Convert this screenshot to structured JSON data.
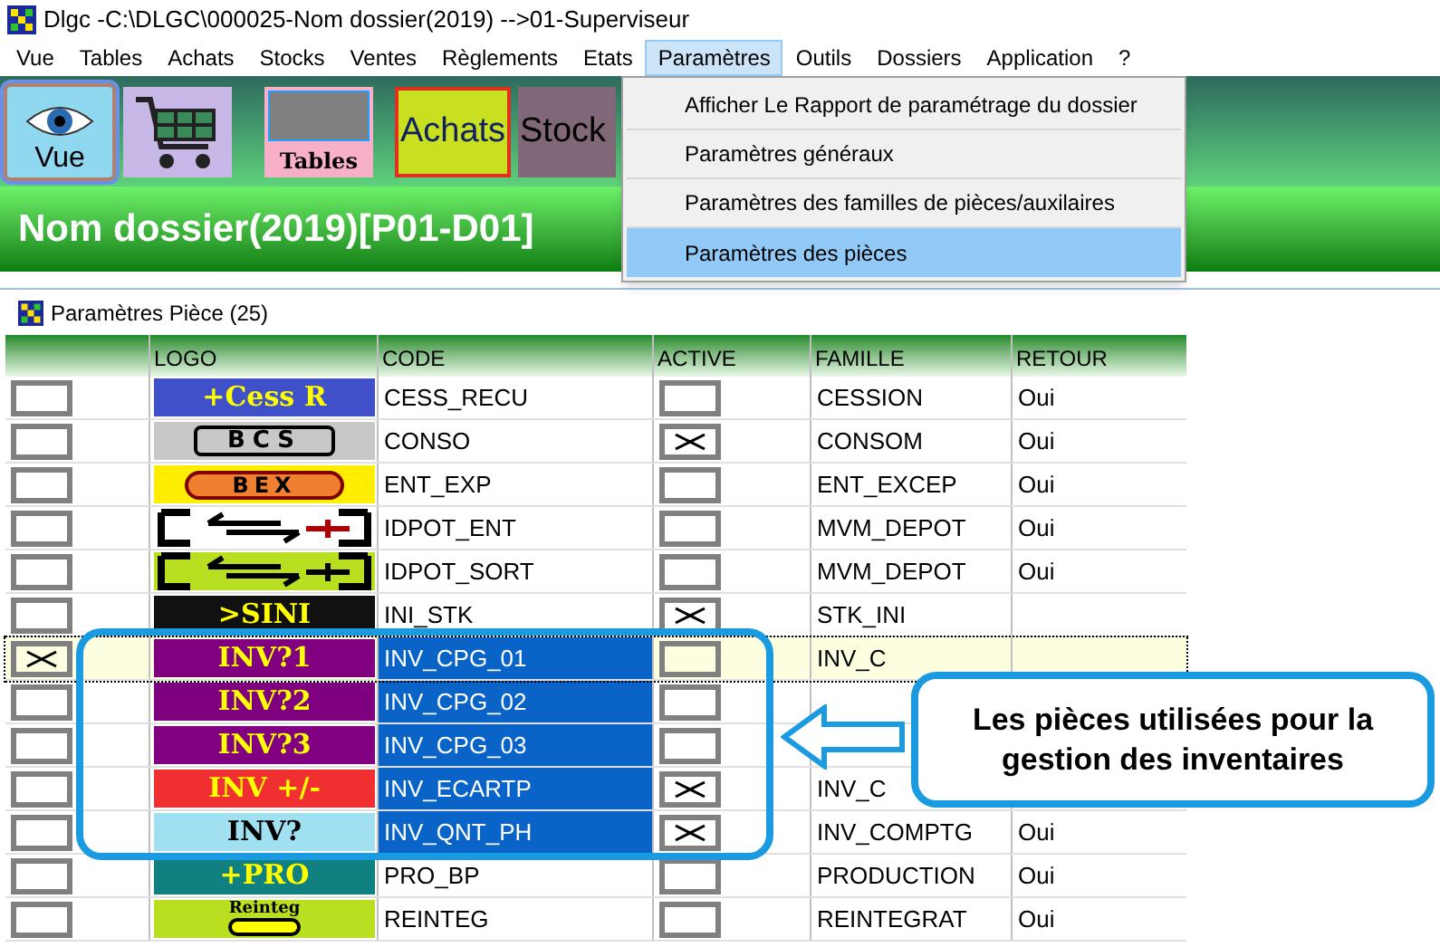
{
  "window": {
    "title": "Dlgc -C:\\DLGC\\000025-Nom dossier(2019) -->01-Superviseur"
  },
  "menu": [
    {
      "label": "Vue",
      "selected": false
    },
    {
      "label": "Tables",
      "selected": false
    },
    {
      "label": "Achats",
      "selected": false
    },
    {
      "label": "Stocks",
      "selected": false
    },
    {
      "label": "Ventes",
      "selected": false
    },
    {
      "label": "Règlements",
      "selected": false
    },
    {
      "label": "Etats",
      "selected": false
    },
    {
      "label": "Paramètres",
      "selected": true
    },
    {
      "label": "Outils",
      "selected": false
    },
    {
      "label": "Dossiers",
      "selected": false
    },
    {
      "label": "Application",
      "selected": false
    },
    {
      "label": "?",
      "selected": false
    }
  ],
  "toolbar": [
    {
      "kind": "vue",
      "label": "Vue",
      "selected": true
    },
    {
      "kind": "cart",
      "selected": false
    },
    {
      "kind": "tables",
      "label": "Tables",
      "selected": false
    },
    {
      "kind": "achats",
      "label": "Achats",
      "selected": false
    },
    {
      "kind": "stock",
      "label": "Stock",
      "selected": false
    }
  ],
  "banner": "Nom dossier(2019)[P01-D01]",
  "dropdown": [
    {
      "label": "Afficher Le Rapport de paramétrage du dossier",
      "selected": false
    },
    {
      "label": "Paramètres généraux",
      "selected": false
    },
    {
      "label": "Paramètres des familles de pièces/auxilaires",
      "selected": false
    },
    {
      "label": "Paramètres des pièces",
      "selected": true
    }
  ],
  "panel": {
    "title": "Paramètres Pièce (25)",
    "columns": [
      "LOGO",
      "CODE",
      "ACTIVE",
      "FAMILLE",
      "RETOUR"
    ],
    "rows": [
      {
        "checked": false,
        "logo": {
          "kind": "text",
          "text": "+Cess R",
          "color": "#4050c8"
        },
        "code": "CESS_RECU",
        "active": false,
        "famille": "CESSION",
        "retour": "Oui",
        "selected": false,
        "current": false
      },
      {
        "checked": false,
        "logo": {
          "kind": "framed",
          "text": "BCS",
          "color": "#c8c8c8"
        },
        "code": "CONSO",
        "active": true,
        "famille": "CONSOM",
        "retour": "Oui",
        "selected": false,
        "current": false
      },
      {
        "checked": false,
        "logo": {
          "kind": "oval",
          "text": "BEX",
          "color": "#ffee00"
        },
        "code": "ENT_EXP",
        "active": false,
        "famille": "ENT_EXCEP",
        "retour": "Oui",
        "selected": false,
        "current": false
      },
      {
        "checked": false,
        "logo": {
          "kind": "arrows",
          "color": "#ffffff"
        },
        "code": "IDPOT_ENT",
        "active": false,
        "famille": "MVM_DEPOT",
        "retour": "Oui",
        "selected": false,
        "current": false
      },
      {
        "checked": false,
        "logo": {
          "kind": "arrows",
          "color": "#b8e020"
        },
        "code": "IDPOT_SORT",
        "active": false,
        "famille": "MVM_DEPOT",
        "retour": "Oui",
        "selected": false,
        "current": false
      },
      {
        "checked": false,
        "logo": {
          "kind": "text",
          "text": ">SINI",
          "color": "#111111"
        },
        "code": "INI_STK",
        "active": true,
        "famille": "STK_INI",
        "selected": false,
        "current": false
      },
      {
        "checked": true,
        "logo": {
          "kind": "text",
          "text": "INV?1",
          "color": "#800080"
        },
        "code": "INV_CPG_01",
        "active": false,
        "famille": "INV_C",
        "selected": true,
        "current": true
      },
      {
        "checked": false,
        "logo": {
          "kind": "text",
          "text": "INV?2",
          "color": "#7f007f"
        },
        "code": "INV_CPG_02",
        "active": false,
        "selected": true,
        "current": false
      },
      {
        "checked": false,
        "logo": {
          "kind": "text",
          "text": "INV?3",
          "color": "#810081"
        },
        "code": "INV_CPG_03",
        "active": false,
        "selected": true,
        "current": false
      },
      {
        "checked": false,
        "logo": {
          "kind": "text",
          "text": "INV +/-",
          "color": "#f03030"
        },
        "code": "INV_ECARTP",
        "active": true,
        "famille": "INV_C",
        "selected": true,
        "current": false
      },
      {
        "checked": false,
        "logo": {
          "kind": "text",
          "text": "INV?",
          "color": "#a0e0f0"
        },
        "code": "INV_QNT_PH",
        "active": true,
        "famille": "INV_COMPTG",
        "retour": "Oui",
        "selected": true,
        "current": false
      },
      {
        "checked": false,
        "logo": {
          "kind": "text",
          "text": "+PRO",
          "color": "#108080"
        },
        "code": "PRO_BP",
        "active": false,
        "famille": "PRODUCTION",
        "retour": "Oui",
        "selected": false,
        "current": false
      },
      {
        "checked": false,
        "logo": {
          "kind": "reinteg",
          "text": "Reinteg",
          "color": "#b8e020"
        },
        "code": "REINTEG",
        "active": false,
        "famille": "REINTEGRAT",
        "retour": "Oui",
        "selected": false,
        "current": false
      }
    ]
  },
  "callout": {
    "text": "Les pièces utilisées pour la gestion des inventaires"
  }
}
